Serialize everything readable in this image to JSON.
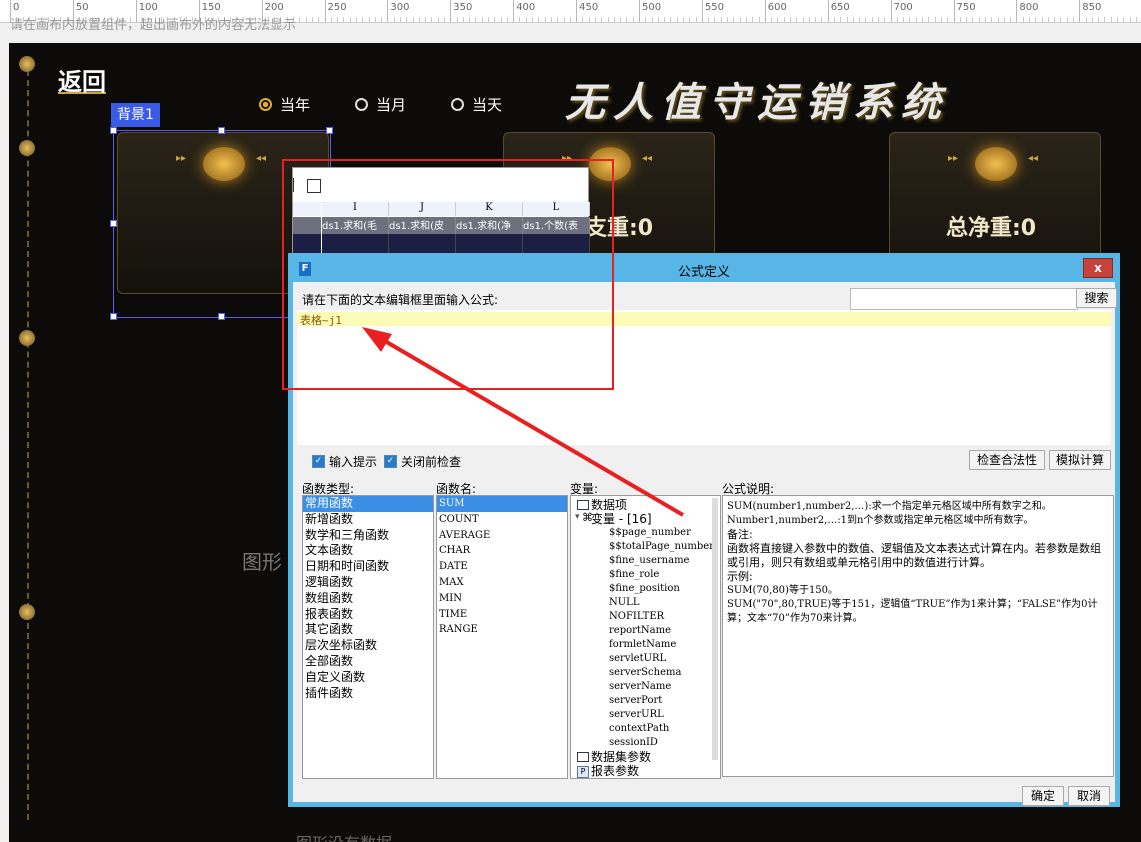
{
  "ruler": {
    "marks": [
      "0",
      "50",
      "100",
      "150",
      "200",
      "250",
      "300",
      "350",
      "400",
      "450",
      "500",
      "550",
      "600",
      "650",
      "700",
      "750",
      "800",
      "850"
    ]
  },
  "canvas_hint": "请在画布内放置组件，超出画布外的内容无法显示",
  "dashboard": {
    "back_label": "返回",
    "title": "无人值守运销系统",
    "period_options": [
      {
        "label": "当年",
        "selected": true
      },
      {
        "label": "当月",
        "selected": false
      },
      {
        "label": "当天",
        "selected": false
      }
    ],
    "card_values": {
      "middle": "支重:0",
      "right": "总净重:0"
    },
    "partial_text_1": "图形",
    "partial_text_2": "图形没有数据"
  },
  "selection": {
    "label": "背景1"
  },
  "table_preview": {
    "columns": [
      "I",
      "J",
      "K",
      "L"
    ],
    "cells": [
      "ds1.求和(毛",
      "ds1.求和(皮",
      "ds1.求和(净",
      "ds1.个数(表"
    ]
  },
  "dialog": {
    "title": "公式定义",
    "close_label": "x",
    "prompt": "请在下面的文本编辑框里面输入公式:",
    "search_placeholder": "",
    "search_button": "搜索",
    "formula_value": "表格~j1",
    "input_hint_label": "输入提示",
    "check_before_close_label": "关闭前检查",
    "check_validity_button": "检查合法性",
    "simulate_button": "模拟计算",
    "func_type_label": "函数类型:",
    "func_name_label": "函数名:",
    "variable_label": "变量:",
    "description_label": "公式说明:",
    "function_types": [
      "常用函数",
      "新增函数",
      "数学和三角函数",
      "文本函数",
      "日期和时间函数",
      "逻辑函数",
      "数组函数",
      "报表函数",
      "其它函数",
      "层次坐标函数",
      "全部函数",
      "自定义函数",
      "插件函数"
    ],
    "function_names": [
      "SUM",
      "COUNT",
      "AVERAGE",
      "CHAR",
      "DATE",
      "MAX",
      "MIN",
      "TIME",
      "RANGE"
    ],
    "variables": {
      "data_item": "数据项",
      "var_group": "变量 - [16]",
      "items": [
        "$$page_number",
        "$$totalPage_number",
        "$fine_username",
        "$fine_role",
        "$fine_position",
        "NULL",
        "NOFILTER",
        "reportName",
        "formletName",
        "servletURL",
        "serverSchema",
        "serverName",
        "serverPort",
        "serverURL",
        "contextPath",
        "sessionID"
      ],
      "dataset_params": "数据集参数",
      "report_params": "报表参数"
    },
    "description": {
      "line1": "SUM(number1,number2,…):求一个指定单元格区域中所有数字之和。",
      "line2": "Number1,number2,…:1到n个参数或指定单元格区域中所有数字。",
      "note_label": "备注:",
      "note": "函数将直接键入参数中的数值、逻辑值及文本表达式计算在内。若参数是数组或引用，则只有数组或单元格引用中的数值进行计算。",
      "example_label": "示例:",
      "example1": "SUM(70,80)等于150。",
      "example2": "SUM(\"70\",80,TRUE)等于151，逻辑值“TRUE”作为1来计算；“FALSE”作为0计算；文本“70”作为70来计算。"
    },
    "ok_button": "确定",
    "cancel_button": "取消"
  },
  "colors": {
    "dialog_border": "#57b6e6",
    "selection": "#3a8ee6",
    "annotation_red": "#e82020",
    "gold": "#c9a640"
  }
}
